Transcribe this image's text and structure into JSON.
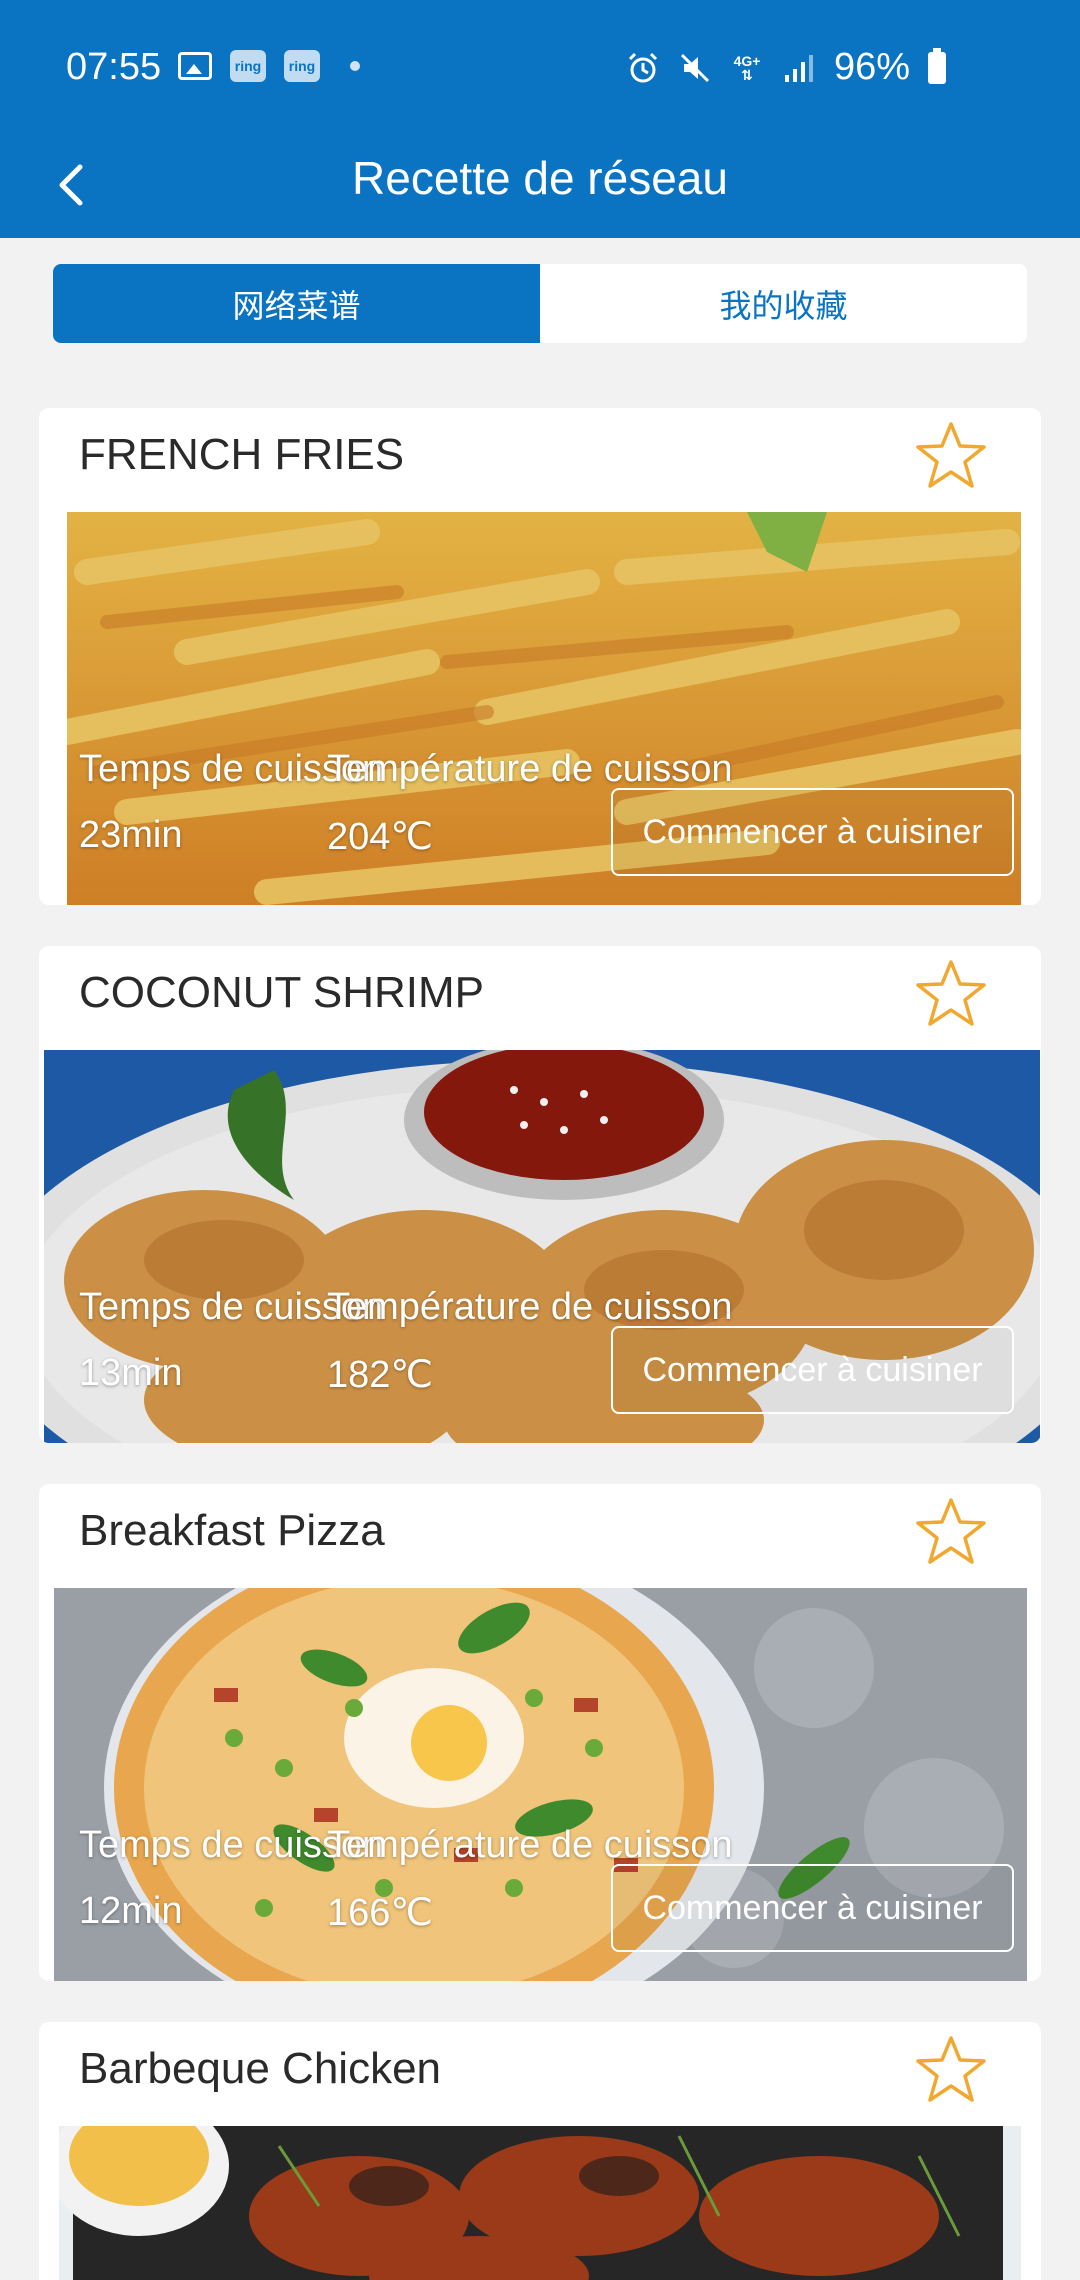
{
  "status": {
    "time": "07:55",
    "net": "4G+",
    "battery": "96%"
  },
  "header": {
    "title": "Recette de réseau"
  },
  "tabs": [
    {
      "label": "网络菜谱",
      "active": true
    },
    {
      "label": "我的收藏",
      "active": false
    }
  ],
  "labels": {
    "time": "Temps de cuisson",
    "temp": "Température de cuisson",
    "start": "Commencer à cuisiner"
  },
  "recipes": [
    {
      "name": "FRENCH FRIES",
      "time": "23min",
      "temp": "204℃",
      "favorite": false
    },
    {
      "name": "COCONUT SHRIMP",
      "time": "13min",
      "temp": "182℃",
      "favorite": false
    },
    {
      "name": "Breakfast Pizza",
      "time": "12min",
      "temp": "166℃",
      "favorite": false
    },
    {
      "name": "Barbeque Chicken",
      "favorite": false
    }
  ],
  "colors": {
    "primary": "#0a74c2",
    "star": "#f0a830",
    "background": "#f2f2f2"
  }
}
